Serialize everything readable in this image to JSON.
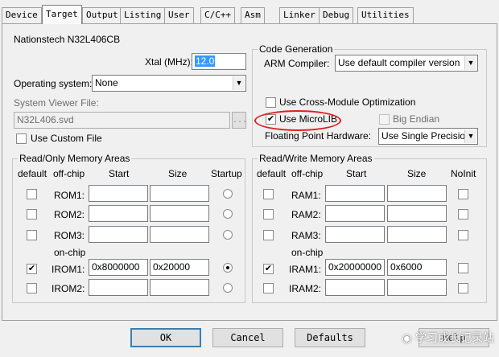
{
  "tabs": [
    {
      "label": "Device"
    },
    {
      "label": "Target"
    },
    {
      "label": "Output"
    },
    {
      "label": "Listing"
    },
    {
      "label": "User"
    },
    {
      "label": "C/C++"
    },
    {
      "label": "Asm"
    },
    {
      "label": "Linker"
    },
    {
      "label": "Debug"
    },
    {
      "label": "Utilities"
    }
  ],
  "device_name": "Nationstech N32L406CB",
  "xtal": {
    "label": "Xtal (MHz):",
    "value": "12.0"
  },
  "os": {
    "label": "Operating system:",
    "value": "None"
  },
  "svf": {
    "label": "System Viewer File:",
    "value": "N32L406.svd",
    "browse": "...",
    "custom_label": "Use Custom File"
  },
  "codegen": {
    "title": "Code Generation",
    "arm_compiler_label": "ARM Compiler:",
    "arm_compiler_value": "Use default compiler version",
    "cross_module": "Use Cross-Module Optimization",
    "microlib": "Use MicroLIB",
    "big_endian": "Big Endian",
    "fp_label": "Floating Point Hardware:",
    "fp_value": "Use Single Precision"
  },
  "rom": {
    "title": "Read/Only Memory Areas",
    "headers": {
      "default": "default",
      "offchip": "off-chip",
      "start": "Start",
      "size": "Size",
      "startup": "Startup"
    },
    "onchip_label": "on-chip",
    "rows": [
      {
        "name": "ROM1:",
        "start": "",
        "size": "",
        "checked": false,
        "startup": false
      },
      {
        "name": "ROM2:",
        "start": "",
        "size": "",
        "checked": false,
        "startup": false
      },
      {
        "name": "ROM3:",
        "start": "",
        "size": "",
        "checked": false,
        "startup": false
      },
      {
        "name": "IROM1:",
        "start": "0x8000000",
        "size": "0x20000",
        "checked": true,
        "startup": true
      },
      {
        "name": "IROM2:",
        "start": "",
        "size": "",
        "checked": false,
        "startup": false
      }
    ]
  },
  "ram": {
    "title": "Read/Write Memory Areas",
    "headers": {
      "default": "default",
      "offchip": "off-chip",
      "start": "Start",
      "size": "Size",
      "noinit": "NoInit"
    },
    "onchip_label": "on-chip",
    "rows": [
      {
        "name": "RAM1:",
        "start": "",
        "size": "",
        "checked": false,
        "noinit": false
      },
      {
        "name": "RAM2:",
        "start": "",
        "size": "",
        "checked": false,
        "noinit": false
      },
      {
        "name": "RAM3:",
        "start": "",
        "size": "",
        "checked": false,
        "noinit": false
      },
      {
        "name": "IRAM1:",
        "start": "0x20000000",
        "size": "0x6000",
        "checked": true,
        "noinit": false
      },
      {
        "name": "IRAM2:",
        "start": "",
        "size": "",
        "checked": false,
        "noinit": false
      }
    ]
  },
  "buttons": {
    "ok": "OK",
    "cancel": "Cancel",
    "defaults": "Defaults",
    "help": "Help"
  },
  "watermark": "学习成长记录站",
  "annotation_color": "#e02020"
}
